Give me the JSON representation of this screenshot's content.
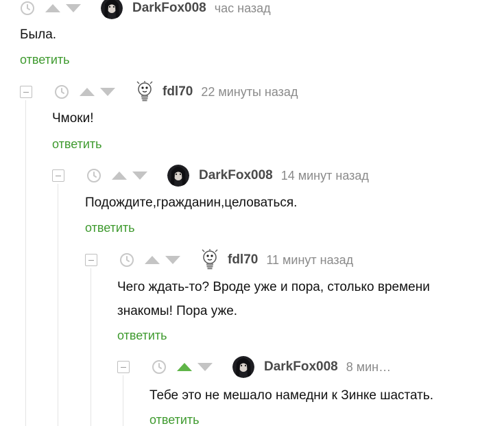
{
  "comments": [
    {
      "author": "DarkFox008",
      "time": "час назад",
      "text": [
        "Была."
      ],
      "reply_label": "ответить"
    },
    {
      "author": "fdl70",
      "time": "22 минуты назад",
      "text": [
        "Чмоки!"
      ],
      "reply_label": "ответить"
    },
    {
      "author": "DarkFox008",
      "time": "14 минут назад",
      "text": [
        "Подождите,гражданин,целоваться."
      ],
      "reply_label": "ответить"
    },
    {
      "author": "fdl70",
      "time": "11 минут назад",
      "text": [
        "Чего ждать-то? Вроде уже и пора, столько времени",
        "знакомы! Пора уже."
      ],
      "reply_label": "ответить"
    },
    {
      "author": "DarkFox008",
      "time": "8 мин…",
      "text": [
        "Тебе это не мешало намедни к Зинке шастать."
      ],
      "reply_label": "ответить",
      "upvoted": true
    }
  ],
  "colors": {
    "reply_link": "#3e9a2e",
    "upvote_active": "#5fb548",
    "vote_inactive": "#c4c4c4",
    "meta_text": "#8a8a8a",
    "username": "#4a4a4a"
  },
  "icons": {
    "collapse": "minus-square-icon",
    "clock": "clock-icon",
    "upvote": "arrow-up-icon",
    "downvote": "arrow-down-icon",
    "avatar_fox": "dark-portrait-avatar",
    "avatar_bulb": "lightbulb-avatar"
  }
}
